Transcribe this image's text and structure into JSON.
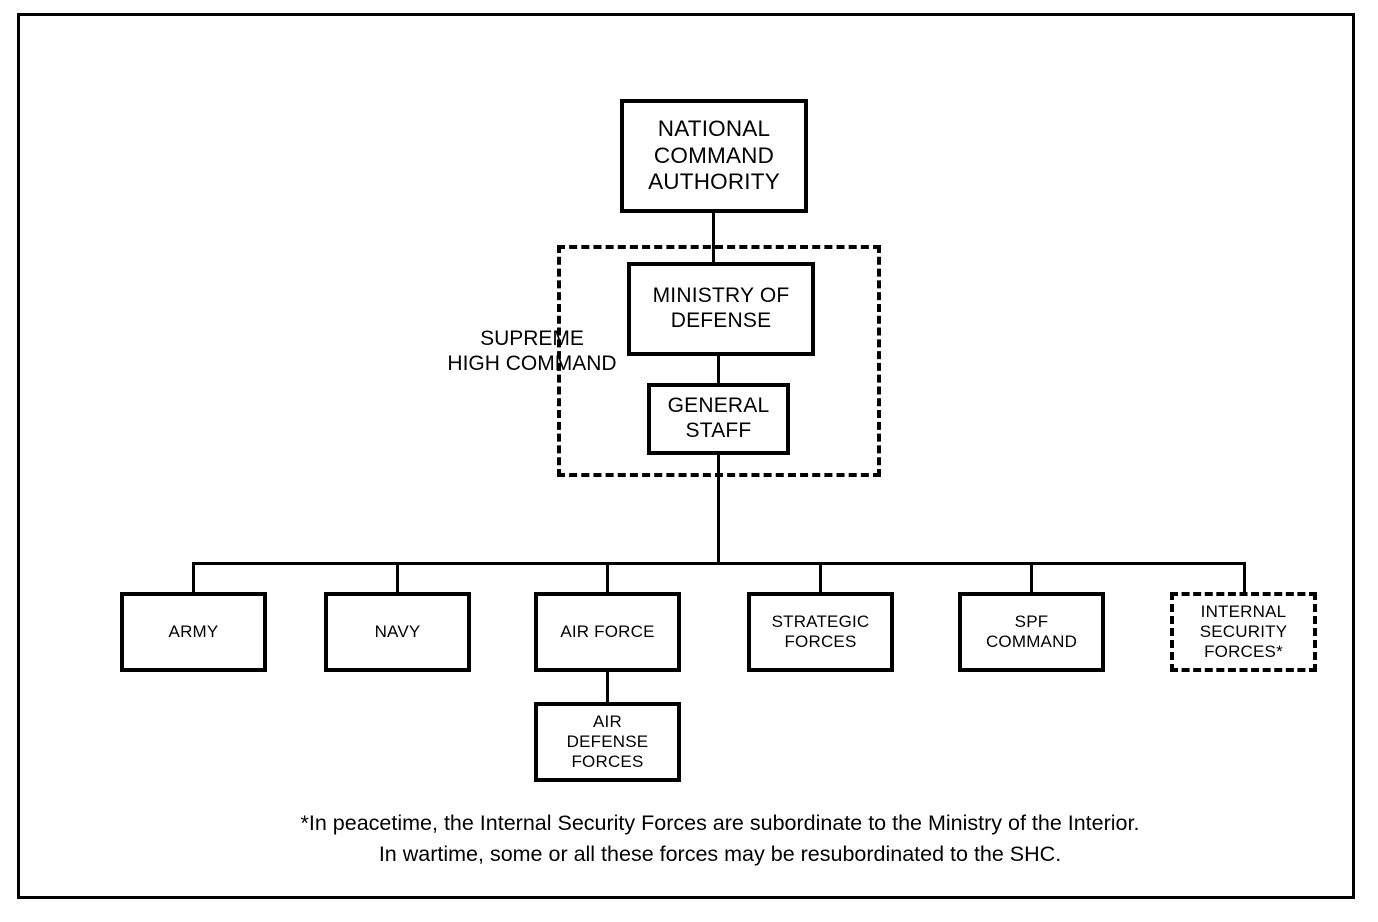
{
  "diagram": {
    "title": "Military Command Structure Organizational Chart",
    "colors": {
      "line": "#000000",
      "background": "#ffffff",
      "text": "#000000"
    },
    "nodes": {
      "national_command_authority": "NATIONAL\nCOMMAND\nAUTHORITY",
      "ministry_of_defense": "MINISTRY OF\nDEFENSE",
      "general_staff": "GENERAL\nSTAFF",
      "army": "ARMY",
      "navy": "NAVY",
      "air_force": "AIR FORCE",
      "strategic_forces": "STRATEGIC\nFORCES",
      "spf_command": "SPF\nCOMMAND",
      "internal_security_forces": "INTERNAL\nSECURITY\nFORCES*",
      "air_defense_forces": "AIR\nDEFENSE\nFORCES"
    },
    "groups": {
      "supreme_high_command": "SUPREME\nHIGH COMMAND"
    },
    "footnote": "*In peacetime, the Internal Security Forces are subordinate to the Ministry of the Interior.\nIn wartime, some or all these forces may be resubordinated to the SHC."
  }
}
